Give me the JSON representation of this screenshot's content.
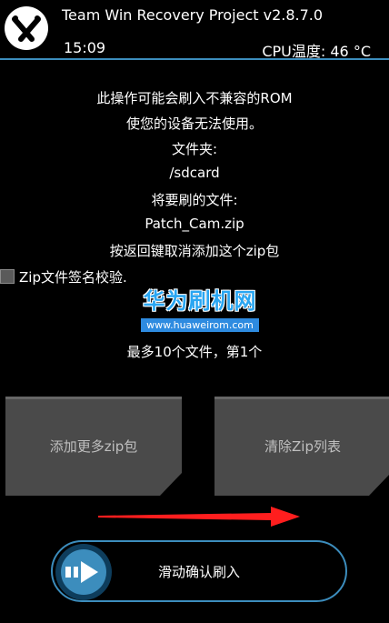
{
  "header": {
    "title": "Team Win Recovery Project  v2.8.7.0",
    "time": "15:09",
    "cpu_temp": "CPU温度: 46 °C",
    "logo_icon": "twrp-logo-icon"
  },
  "message": {
    "warning_line1": "此操作可能会刷入不兼容的ROM",
    "warning_line2": "使您的设备无法使用。",
    "folder_label": "文件夹:",
    "folder_path": "/sdcard",
    "file_label": "将要刷的文件:",
    "file_name": "Patch_Cam.zip",
    "cancel_hint": "按返回键取消添加这个zip包"
  },
  "zip_verify": {
    "label": "Zip文件签名校验.",
    "checked": false
  },
  "watermark": {
    "brand": "华为刷机网",
    "url": "www.huaweirom.com"
  },
  "queue_info": "最多10个文件，第1个",
  "buttons": {
    "add_more": "添加更多zip包",
    "clear_list": "清除Zip列表"
  },
  "swipe": {
    "label": "滑动确认刷入"
  },
  "colors": {
    "accent": "#3c8dbd",
    "button_bg": "#4a4a4a",
    "arrow": "#ff1e1e",
    "watermark": "#29a6f2"
  }
}
